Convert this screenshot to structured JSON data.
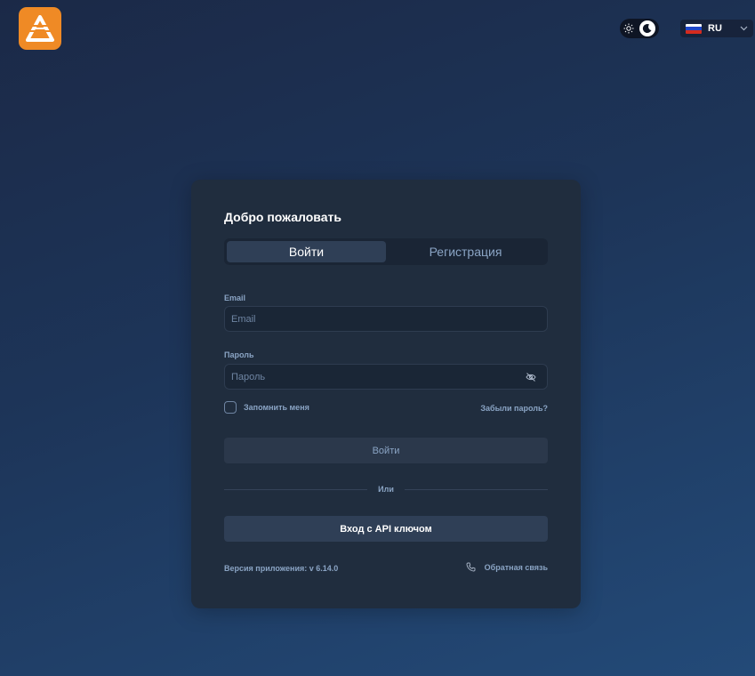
{
  "header": {
    "logo_icon": "logo-icon",
    "theme_toggle": {
      "icons": [
        "sun-icon",
        "moon-icon"
      ],
      "mode": "dark"
    },
    "language": {
      "code": "RU",
      "flag_icon": "russia-flag-icon",
      "flag_colors": [
        "#ffffff",
        "#1f47c9",
        "#d52b1e"
      ]
    }
  },
  "card": {
    "title": "Добро пожаловать",
    "tabs": [
      {
        "label": "Войти",
        "active": true
      },
      {
        "label": "Регистрация",
        "active": false
      }
    ],
    "email": {
      "label": "Email",
      "placeholder": "Email",
      "value": ""
    },
    "password": {
      "label": "Пароль",
      "placeholder": "Пароль",
      "value": "",
      "toggle_icon": "eye-off-icon"
    },
    "remember_label": "Запомнить меня",
    "forgot_label": "Забыли пароль?",
    "login_button": "Войти",
    "divider_text": "Или",
    "api_button": "Вход с API ключом",
    "version": "Версия приложения: v 6.14.0",
    "feedback": {
      "label": "Обратная связь",
      "icon": "phone-icon"
    }
  },
  "colors": {
    "accent": "#ef8a25",
    "card_bg": "#202d3e",
    "muted_text": "#8aa4c4"
  }
}
